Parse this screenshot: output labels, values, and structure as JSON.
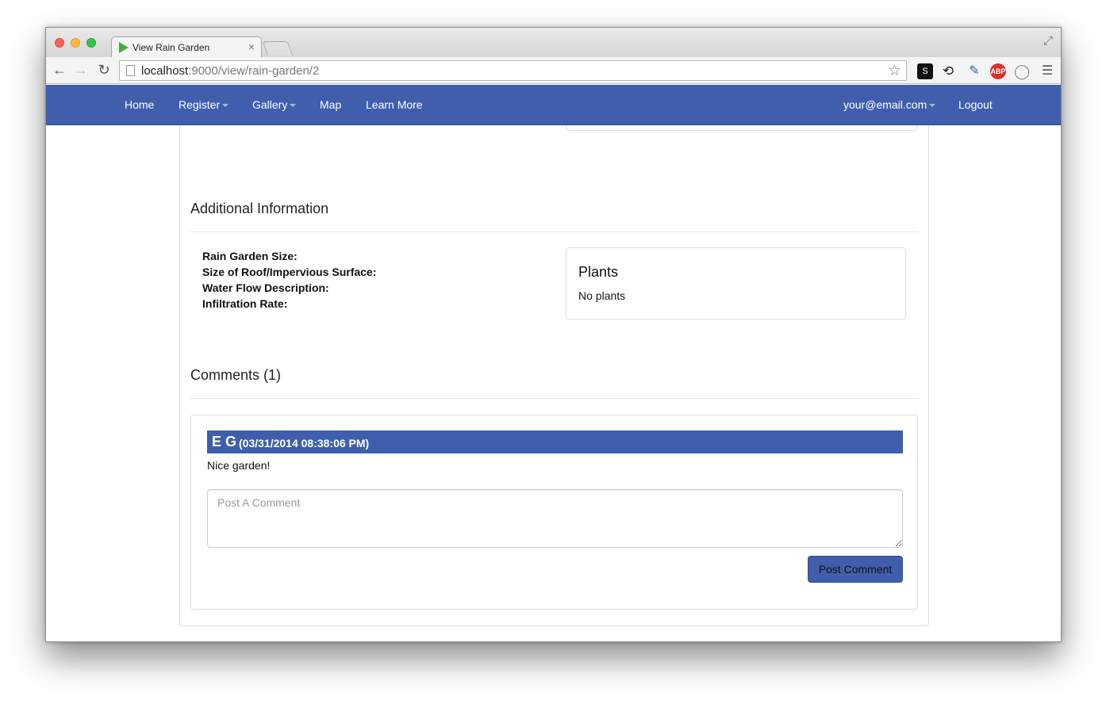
{
  "browser": {
    "tab_title": "View Rain Garden",
    "tab_close": "×",
    "url_host": "localhost",
    "url_path": ":9000/view/rain-garden/2"
  },
  "navbar": {
    "home": "Home",
    "register": "Register",
    "gallery": "Gallery",
    "map": "Map",
    "learn_more": "Learn More",
    "user_email": "your@email.com",
    "logout": "Logout"
  },
  "additional_info": {
    "title": "Additional Information",
    "labels": [
      "Rain Garden Size:",
      "Size of Roof/Impervious Surface:",
      "Water Flow Description:",
      "Infiltration Rate:"
    ],
    "plants_title": "Plants",
    "plants_text": "No plants"
  },
  "comments": {
    "title": "Comments (1)",
    "items": [
      {
        "author": "E G",
        "date": "(03/31/2014 08:38:06 PM)",
        "text": "Nice garden!"
      }
    ],
    "input_placeholder": "Post A Comment",
    "post_button": "Post Comment"
  },
  "colors": {
    "brand": "#3f5fad"
  },
  "icons": {
    "back": "arrow-left-icon",
    "forward": "arrow-right-icon",
    "reload": "reload-icon",
    "bookmark": "star-icon"
  }
}
